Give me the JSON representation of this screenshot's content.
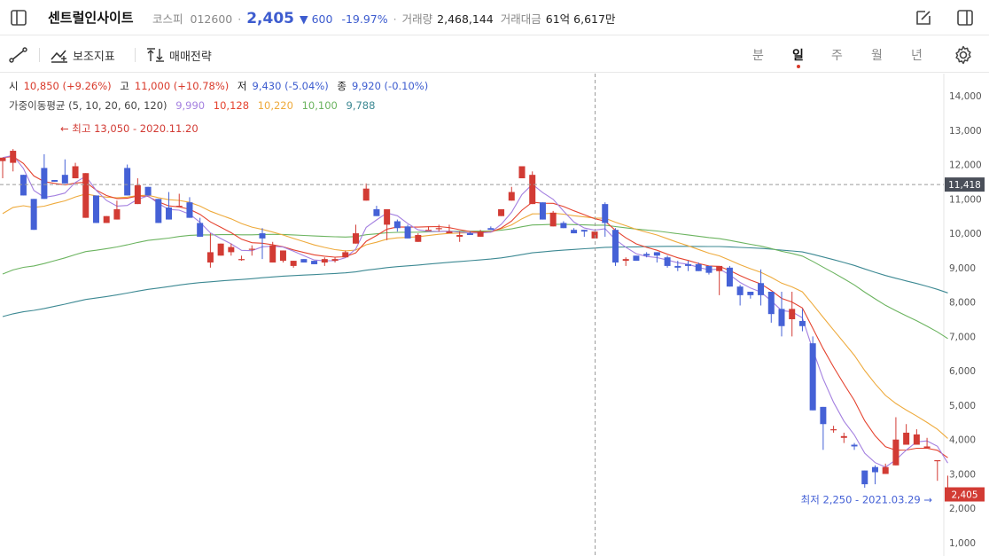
{
  "header": {
    "stock_name": "센트럴인사이트",
    "market": "코스피",
    "code": "012600",
    "price": "2,405",
    "change": "▼ 600",
    "change_pct": "-19.97%",
    "volume_label": "거래량",
    "volume": "2,468,144",
    "amount_label": "거래대금",
    "amount": "61억 6,617만"
  },
  "toolbar": {
    "indicator_label": "보조지표",
    "strategy_label": "매매전략",
    "periods": [
      "분",
      "일",
      "주",
      "월",
      "년"
    ],
    "active_period": "일"
  },
  "ohlc_legend": {
    "open_label": "시",
    "open": "10,850 (+9.26%)",
    "high_label": "고",
    "high": "11,000 (+10.78%)",
    "low_label": "저",
    "low": "9,430 (-5.04%)",
    "close_label": "종",
    "close": "9,920 (-0.10%)"
  },
  "ma_legend": {
    "label": "가중이동평균 (5, 10, 20, 60, 120)",
    "ma5": "9,990",
    "ma10": "10,128",
    "ma20": "10,220",
    "ma60": "10,100",
    "ma120": "9,788"
  },
  "colors": {
    "up": "#d23b34",
    "down": "#4561d6",
    "ma5": "#a480e0",
    "ma10": "#e5432f",
    "ma20": "#eeaa3c",
    "ma60": "#6cb460",
    "ma120": "#3d8993"
  },
  "chart_data": {
    "type": "candlestick",
    "y_ticks": [
      "14,000",
      "13,000",
      "12,000",
      "11,000",
      "10,000",
      "9,000",
      "8,000",
      "7,000",
      "6,000",
      "5,000",
      "4,000",
      "3,000",
      "2,000",
      "1,000"
    ],
    "ylim": [
      700,
      14600
    ],
    "crosshair_price": "11,418",
    "crosshair_value": 11418,
    "last_price_label": "2,405",
    "last_price": 2405,
    "high_annotation": "← 최고 13,050 - 2020.11.20",
    "low_annotation": "최저 2,250 - 2021.03.29 →",
    "candles": [
      [
        12100,
        12200,
        11600,
        12200
      ],
      [
        12050,
        12400,
        11800,
        12450
      ],
      [
        11700,
        11100,
        12000,
        11400
      ],
      [
        11000,
        10100,
        11500,
        10550
      ],
      [
        11900,
        11000,
        11850,
        12300
      ],
      [
        11550,
        11500,
        13050,
        11500
      ],
      [
        11700,
        11450,
        11950,
        12150
      ],
      [
        11600,
        11950,
        11650,
        12050
      ],
      [
        10450,
        11750,
        11350,
        11650
      ],
      [
        11100,
        10300,
        11300,
        10500
      ],
      [
        10300,
        10500,
        11450,
        10350
      ],
      [
        10400,
        10700,
        11500,
        10950
      ],
      [
        11900,
        11100,
        11850,
        12000
      ],
      [
        10850,
        11400,
        11950,
        11600
      ],
      [
        11350,
        11100,
        11600,
        11350
      ],
      [
        11000,
        10300,
        10950,
        11000
      ],
      [
        10750,
        10400,
        11050,
        11200
      ],
      [
        10800,
        10800,
        10950,
        11150
      ],
      [
        10900,
        10450,
        11200,
        11050
      ],
      [
        10300,
        9900,
        10450,
        10450
      ],
      [
        9150,
        9450,
        9000,
        10000
      ],
      [
        9350,
        9700,
        9600,
        9550
      ],
      [
        9450,
        9600,
        9350,
        9700
      ],
      [
        9250,
        9250,
        9200,
        9350
      ],
      [
        9550,
        9550,
        9350,
        9650
      ],
      [
        10000,
        9850,
        9250,
        10150
      ],
      [
        9150,
        9650,
        9150,
        9750
      ],
      [
        9200,
        9500,
        9150,
        9250
      ],
      [
        9050,
        9200,
        9000,
        9200
      ],
      [
        9250,
        9150,
        9150,
        9250
      ],
      [
        9200,
        9100,
        9100,
        9200
      ],
      [
        9150,
        9250,
        9050,
        9300
      ],
      [
        9200,
        9250,
        9150,
        9300
      ],
      [
        9300,
        9450,
        9450,
        9500
      ],
      [
        9700,
        10000,
        10150,
        10250
      ],
      [
        10950,
        11300,
        11200,
        11450
      ],
      [
        10700,
        10500,
        10800,
        10800
      ],
      [
        10250,
        10700,
        9800,
        10700
      ],
      [
        10350,
        10150,
        10050,
        10400
      ],
      [
        10200,
        9850,
        10050,
        10250
      ],
      [
        9750,
        9950,
        9950,
        10000
      ],
      [
        10100,
        10100,
        10200,
        10200
      ],
      [
        10150,
        10150,
        10050,
        10250
      ],
      [
        10000,
        10050,
        10000,
        10250
      ],
      [
        9900,
        9950,
        9750,
        10050
      ],
      [
        10000,
        9950,
        9950,
        10050
      ],
      [
        9900,
        10050,
        10050,
        10100
      ],
      [
        10150,
        10100,
        10100,
        10200
      ],
      [
        10500,
        10700,
        10600,
        10600
      ],
      [
        10950,
        11200,
        11300,
        11350
      ],
      [
        11600,
        11950,
        11900,
        11900
      ],
      [
        10850,
        11700,
        11800,
        11800
      ],
      [
        10900,
        10400,
        10700,
        10900
      ],
      [
        10200,
        10600,
        10500,
        10650
      ],
      [
        10300,
        10150,
        10200,
        10350
      ],
      [
        10100,
        10000,
        10000,
        10150
      ],
      [
        10100,
        10050,
        9900,
        10100
      ],
      [
        9850,
        10050,
        10050,
        10000
      ],
      [
        10850,
        10300,
        9900,
        10900
      ],
      [
        10100,
        9150,
        9050,
        10150
      ],
      [
        9200,
        9250,
        9050,
        9300
      ],
      [
        9350,
        9200,
        9300,
        9350
      ],
      [
        9400,
        9350,
        9300,
        9450
      ],
      [
        9450,
        9350,
        9150,
        9450
      ],
      [
        9300,
        9050,
        9000,
        9350
      ],
      [
        9050,
        9000,
        8900,
        9200
      ],
      [
        9100,
        9050,
        8900,
        9200
      ],
      [
        9100,
        8900,
        8950,
        9150
      ],
      [
        9050,
        8850,
        8800,
        9050
      ],
      [
        8900,
        9050,
        8200,
        9050
      ],
      [
        9000,
        8450,
        8550,
        9050
      ],
      [
        8450,
        8200,
        7900,
        8500
      ],
      [
        8300,
        8200,
        8100,
        8300
      ],
      [
        8550,
        8200,
        7900,
        8950
      ],
      [
        8300,
        7650,
        7400,
        8300
      ],
      [
        7800,
        7300,
        7000,
        8300
      ],
      [
        7500,
        7800,
        7000,
        8300
      ],
      [
        7450,
        7300,
        7150,
        7800
      ],
      [
        6800,
        4850,
        4950,
        7000
      ],
      [
        4950,
        4450,
        3700,
        4950
      ],
      [
        4300,
        4300,
        4200,
        4400
      ],
      [
        4050,
        4100,
        3900,
        4200
      ],
      [
        3850,
        3800,
        3700,
        3900
      ],
      [
        3100,
        2700,
        2600,
        3100
      ],
      [
        3200,
        3050,
        2700,
        3250
      ],
      [
        3000,
        3200,
        3000,
        3300
      ],
      [
        3250,
        4000,
        3500,
        4650
      ],
      [
        3850,
        4200,
        4400,
        4450
      ],
      [
        3850,
        4150,
        4250,
        4300
      ],
      [
        3750,
        3800,
        3950,
        4050
      ],
      [
        3400,
        3400,
        2800,
        3350
      ],
      [
        2400,
        2450,
        2250,
        2950
      ]
    ]
  }
}
